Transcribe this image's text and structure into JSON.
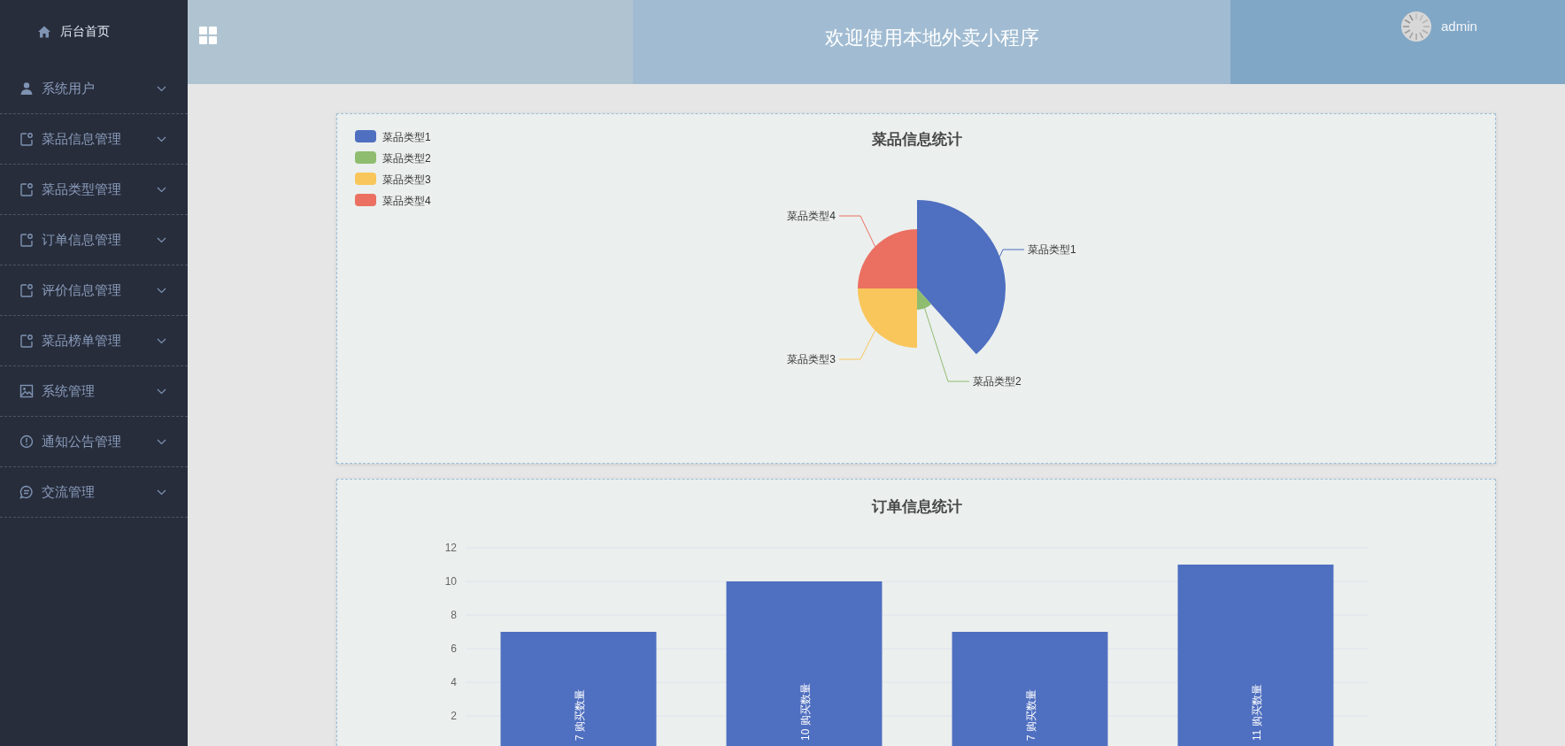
{
  "sidebar": {
    "home": "后台首页",
    "items": [
      {
        "label": "系统用户",
        "kind": "user"
      },
      {
        "label": "菜品信息管理",
        "kind": "note"
      },
      {
        "label": "菜品类型管理",
        "kind": "note"
      },
      {
        "label": "订单信息管理",
        "kind": "note"
      },
      {
        "label": "评价信息管理",
        "kind": "note"
      },
      {
        "label": "菜品榜单管理",
        "kind": "note"
      },
      {
        "label": "系统管理",
        "kind": "image"
      },
      {
        "label": "通知公告管理",
        "kind": "alert"
      },
      {
        "label": "交流管理",
        "kind": "chat"
      }
    ]
  },
  "header": {
    "title": "欢迎使用本地外卖小程序",
    "user": "admin"
  },
  "pie_card": {
    "title": "菜品信息统计",
    "slices": [
      {
        "label": "菜品类型1",
        "color": "#4f6fc0"
      },
      {
        "label": "菜品类型2",
        "color": "#8fbd6f"
      },
      {
        "label": "菜品类型3",
        "color": "#f9c65b"
      },
      {
        "label": "菜品类型4",
        "color": "#eb7061"
      }
    ],
    "slice_labels": [
      "菜品类型1",
      "菜品类型2",
      "菜品类型3",
      "菜品类型4"
    ]
  },
  "order_card": {
    "chart_data": {
      "type": "bar",
      "title": "订单信息统计",
      "series": [
        {
          "name": "购买数量",
          "color": "#4f6fc0",
          "values": [
            7,
            10,
            7,
            11
          ]
        }
      ],
      "ylim": [
        0,
        12
      ],
      "yticks": [
        2,
        4,
        6,
        8,
        10,
        12
      ],
      "data_labels": true,
      "grid": true
    }
  }
}
